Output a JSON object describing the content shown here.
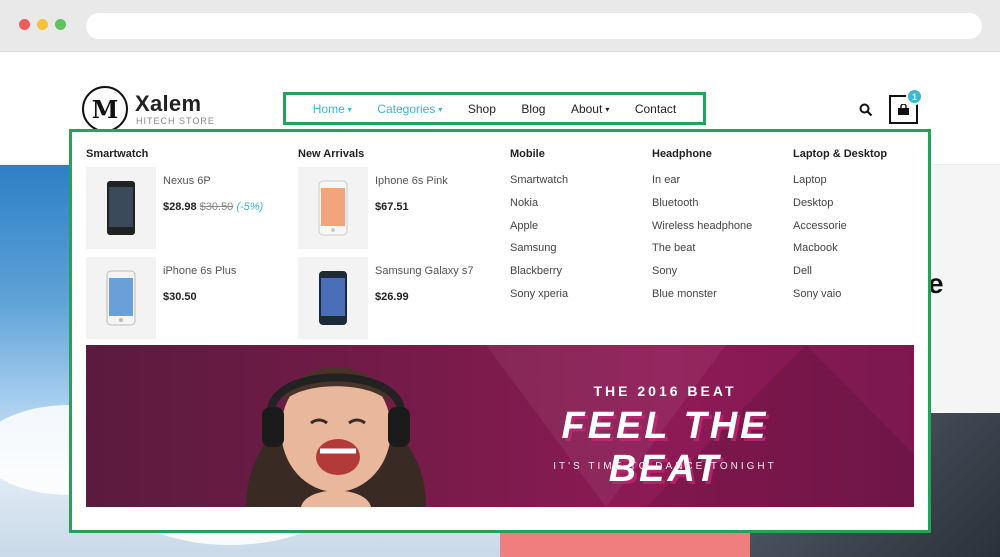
{
  "nav": {
    "items": [
      {
        "label": "Home",
        "caret": "▾"
      },
      {
        "label": "Categories",
        "caret": "▾"
      },
      {
        "label": "Shop",
        "caret": ""
      },
      {
        "label": "Blog",
        "caret": ""
      },
      {
        "label": "About",
        "caret": "▾"
      },
      {
        "label": "Contact",
        "caret": ""
      }
    ]
  },
  "logo": {
    "mark": "M",
    "name": "Xalem",
    "tagline": "HITECH STORE"
  },
  "cart": {
    "count": "1"
  },
  "hero_peek_letter": "e",
  "mega_menu": {
    "smartwatch": {
      "title": "Smartwatch",
      "products": [
        {
          "name": "Nexus 6P",
          "price": "$28.98",
          "old_price": "$30.50",
          "discount": "(-5%)"
        },
        {
          "name": "iPhone 6s Plus",
          "price": "$30.50",
          "old_price": "",
          "discount": ""
        }
      ]
    },
    "new_arrivals": {
      "title": "New Arrivals",
      "products": [
        {
          "name": "Iphone 6s Pink",
          "price": "$67.51"
        },
        {
          "name": "Samsung Galaxy s7",
          "price": "$26.99"
        }
      ]
    },
    "mobile": {
      "title": "Mobile",
      "links": [
        "Smartwatch",
        "Nokia",
        "Apple",
        "Samsung",
        "Blackberry",
        "Sony xperia"
      ]
    },
    "headphone": {
      "title": "Headphone",
      "links": [
        "In ear",
        "Bluetooth",
        "Wireless headphone",
        "The beat",
        "Sony",
        "Blue monster"
      ]
    },
    "laptop": {
      "title": "Laptop & Desktop",
      "links": [
        "Laptop",
        "Desktop",
        "Accessorie",
        "Macbook",
        "Dell",
        "Sony vaio"
      ]
    },
    "banner": {
      "subtitle": "THE 2016 BEAT",
      "headline": "FEEL THE BEAT",
      "tagline": "IT'S TIME TO DANCE TONIGHT"
    }
  },
  "colors": {
    "accent": "#3bb5d8",
    "highlight_box": "#27a05a"
  }
}
